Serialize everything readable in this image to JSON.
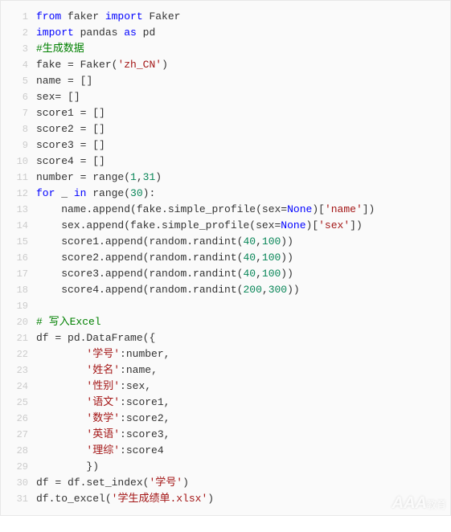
{
  "code": {
    "lines": [
      {
        "n": "1",
        "tokens": [
          [
            "kw",
            "from"
          ],
          [
            "id",
            " faker "
          ],
          [
            "kw",
            "import"
          ],
          [
            "id",
            " Faker"
          ]
        ]
      },
      {
        "n": "2",
        "tokens": [
          [
            "kw",
            "import"
          ],
          [
            "id",
            " pandas "
          ],
          [
            "kw",
            "as"
          ],
          [
            "id",
            " pd"
          ]
        ]
      },
      {
        "n": "3",
        "tokens": [
          [
            "cmt",
            "#生成数据"
          ]
        ]
      },
      {
        "n": "4",
        "tokens": [
          [
            "id",
            "fake "
          ],
          [
            "op",
            "="
          ],
          [
            "id",
            " Faker"
          ],
          [
            "punct",
            "("
          ],
          [
            "str",
            "'zh_CN'"
          ],
          [
            "punct",
            ")"
          ]
        ]
      },
      {
        "n": "5",
        "tokens": [
          [
            "id",
            "name "
          ],
          [
            "op",
            "="
          ],
          [
            "id",
            " "
          ],
          [
            "punct",
            "[]"
          ]
        ]
      },
      {
        "n": "6",
        "tokens": [
          [
            "id",
            "sex"
          ],
          [
            "op",
            "="
          ],
          [
            "id",
            " "
          ],
          [
            "punct",
            "[]"
          ]
        ]
      },
      {
        "n": "7",
        "tokens": [
          [
            "id",
            "score1 "
          ],
          [
            "op",
            "="
          ],
          [
            "id",
            " "
          ],
          [
            "punct",
            "[]"
          ]
        ]
      },
      {
        "n": "8",
        "tokens": [
          [
            "id",
            "score2 "
          ],
          [
            "op",
            "="
          ],
          [
            "id",
            " "
          ],
          [
            "punct",
            "[]"
          ]
        ]
      },
      {
        "n": "9",
        "tokens": [
          [
            "id",
            "score3 "
          ],
          [
            "op",
            "="
          ],
          [
            "id",
            " "
          ],
          [
            "punct",
            "[]"
          ]
        ]
      },
      {
        "n": "10",
        "tokens": [
          [
            "id",
            "score4 "
          ],
          [
            "op",
            "="
          ],
          [
            "id",
            " "
          ],
          [
            "punct",
            "[]"
          ]
        ]
      },
      {
        "n": "11",
        "tokens": [
          [
            "id",
            "number "
          ],
          [
            "op",
            "="
          ],
          [
            "id",
            " range"
          ],
          [
            "punct",
            "("
          ],
          [
            "num",
            "1"
          ],
          [
            "punct",
            ","
          ],
          [
            "num",
            "31"
          ],
          [
            "punct",
            ")"
          ]
        ]
      },
      {
        "n": "12",
        "tokens": [
          [
            "kw",
            "for"
          ],
          [
            "id",
            " _ "
          ],
          [
            "kw",
            "in"
          ],
          [
            "id",
            " range"
          ],
          [
            "punct",
            "("
          ],
          [
            "num",
            "30"
          ],
          [
            "punct",
            "):"
          ]
        ]
      },
      {
        "n": "13",
        "tokens": [
          [
            "id",
            "    name.append"
          ],
          [
            "punct",
            "("
          ],
          [
            "id",
            "fake.simple_profile"
          ],
          [
            "punct",
            "("
          ],
          [
            "id",
            "sex"
          ],
          [
            "op",
            "="
          ],
          [
            "none",
            "None"
          ],
          [
            "punct",
            ")["
          ],
          [
            "str",
            "'name'"
          ],
          [
            "punct",
            "])"
          ]
        ]
      },
      {
        "n": "14",
        "tokens": [
          [
            "id",
            "    sex.append"
          ],
          [
            "punct",
            "("
          ],
          [
            "id",
            "fake.simple_profile"
          ],
          [
            "punct",
            "("
          ],
          [
            "id",
            "sex"
          ],
          [
            "op",
            "="
          ],
          [
            "none",
            "None"
          ],
          [
            "punct",
            ")["
          ],
          [
            "str",
            "'sex'"
          ],
          [
            "punct",
            "])"
          ]
        ]
      },
      {
        "n": "15",
        "tokens": [
          [
            "id",
            "    score1.append"
          ],
          [
            "punct",
            "("
          ],
          [
            "id",
            "random.randint"
          ],
          [
            "punct",
            "("
          ],
          [
            "num",
            "40"
          ],
          [
            "punct",
            ","
          ],
          [
            "num",
            "100"
          ],
          [
            "punct",
            "))"
          ]
        ]
      },
      {
        "n": "16",
        "tokens": [
          [
            "id",
            "    score2.append"
          ],
          [
            "punct",
            "("
          ],
          [
            "id",
            "random.randint"
          ],
          [
            "punct",
            "("
          ],
          [
            "num",
            "40"
          ],
          [
            "punct",
            ","
          ],
          [
            "num",
            "100"
          ],
          [
            "punct",
            "))"
          ]
        ]
      },
      {
        "n": "17",
        "tokens": [
          [
            "id",
            "    score3.append"
          ],
          [
            "punct",
            "("
          ],
          [
            "id",
            "random.randint"
          ],
          [
            "punct",
            "("
          ],
          [
            "num",
            "40"
          ],
          [
            "punct",
            ","
          ],
          [
            "num",
            "100"
          ],
          [
            "punct",
            "))"
          ]
        ]
      },
      {
        "n": "18",
        "tokens": [
          [
            "id",
            "    score4.append"
          ],
          [
            "punct",
            "("
          ],
          [
            "id",
            "random.randint"
          ],
          [
            "punct",
            "("
          ],
          [
            "num",
            "200"
          ],
          [
            "punct",
            ","
          ],
          [
            "num",
            "300"
          ],
          [
            "punct",
            "))"
          ]
        ]
      },
      {
        "n": "19",
        "tokens": []
      },
      {
        "n": "20",
        "tokens": [
          [
            "cmt",
            "# 写入Excel"
          ]
        ]
      },
      {
        "n": "21",
        "tokens": [
          [
            "id",
            "df "
          ],
          [
            "op",
            "="
          ],
          [
            "id",
            " pd.DataFrame"
          ],
          [
            "punct",
            "({"
          ]
        ]
      },
      {
        "n": "22",
        "tokens": [
          [
            "id",
            "        "
          ],
          [
            "str",
            "'学号'"
          ],
          [
            "punct",
            ":"
          ],
          [
            "id",
            "number"
          ],
          [
            "punct",
            ","
          ]
        ]
      },
      {
        "n": "23",
        "tokens": [
          [
            "id",
            "        "
          ],
          [
            "str",
            "'姓名'"
          ],
          [
            "punct",
            ":"
          ],
          [
            "id",
            "name"
          ],
          [
            "punct",
            ","
          ]
        ]
      },
      {
        "n": "24",
        "tokens": [
          [
            "id",
            "        "
          ],
          [
            "str",
            "'性别'"
          ],
          [
            "punct",
            ":"
          ],
          [
            "id",
            "sex"
          ],
          [
            "punct",
            ","
          ]
        ]
      },
      {
        "n": "25",
        "tokens": [
          [
            "id",
            "        "
          ],
          [
            "str",
            "'语文'"
          ],
          [
            "punct",
            ":"
          ],
          [
            "id",
            "score1"
          ],
          [
            "punct",
            ","
          ]
        ]
      },
      {
        "n": "26",
        "tokens": [
          [
            "id",
            "        "
          ],
          [
            "str",
            "'数学'"
          ],
          [
            "punct",
            ":"
          ],
          [
            "id",
            "score2"
          ],
          [
            "punct",
            ","
          ]
        ]
      },
      {
        "n": "27",
        "tokens": [
          [
            "id",
            "        "
          ],
          [
            "str",
            "'英语'"
          ],
          [
            "punct",
            ":"
          ],
          [
            "id",
            "score3"
          ],
          [
            "punct",
            ","
          ]
        ]
      },
      {
        "n": "28",
        "tokens": [
          [
            "id",
            "        "
          ],
          [
            "str",
            "'理综'"
          ],
          [
            "punct",
            ":"
          ],
          [
            "id",
            "score4"
          ]
        ]
      },
      {
        "n": "29",
        "tokens": [
          [
            "id",
            "        "
          ],
          [
            "punct",
            "})"
          ]
        ]
      },
      {
        "n": "30",
        "tokens": [
          [
            "id",
            "df "
          ],
          [
            "op",
            "="
          ],
          [
            "id",
            " df.set_index"
          ],
          [
            "punct",
            "("
          ],
          [
            "str",
            "'学号'"
          ],
          [
            "punct",
            ")"
          ]
        ]
      },
      {
        "n": "31",
        "tokens": [
          [
            "id",
            "df.to_excel"
          ],
          [
            "punct",
            "("
          ],
          [
            "str",
            "'学生成绩单.xlsx'"
          ],
          [
            "punct",
            ")"
          ]
        ]
      }
    ]
  },
  "watermark": {
    "main": "AAA",
    "sub": "教育"
  }
}
